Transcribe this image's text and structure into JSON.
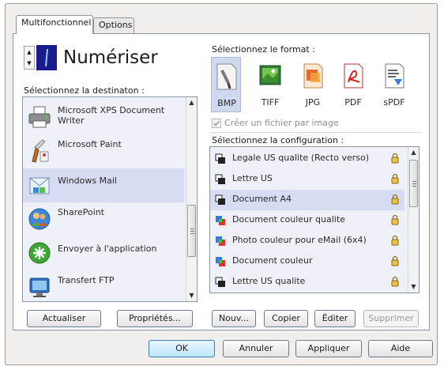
{
  "tabs": {
    "multifunctional": "Multifonctionnel",
    "options": "Options"
  },
  "scan_button": {
    "label": "Numériser"
  },
  "destination": {
    "heading": "Sélectionnez la destinaton :",
    "items": [
      {
        "label": "Microsoft XPS Document Writer",
        "icon": "printer-icon"
      },
      {
        "label": "Microsoft Paint",
        "icon": "paint-icon"
      },
      {
        "label": "Windows Mail",
        "icon": "windows-mail-icon"
      },
      {
        "label": "SharePoint",
        "icon": "sharepoint-icon"
      },
      {
        "label": "Envoyer à l'application",
        "icon": "send-to-application-icon"
      },
      {
        "label": "Transfert FTP",
        "icon": "ftp-transfer-icon"
      }
    ],
    "selected": "Windows Mail"
  },
  "format": {
    "heading": "Sélectionnez le format :",
    "items": [
      {
        "label": "BMP",
        "icon": "bmp-icon"
      },
      {
        "label": "TIFF",
        "icon": "tiff-icon"
      },
      {
        "label": "JPG",
        "icon": "jpg-icon"
      },
      {
        "label": "PDF",
        "icon": "pdf-icon"
      },
      {
        "label": "sPDF",
        "icon": "spdf-icon"
      }
    ],
    "selected": "BMP",
    "checkbox_label": "Créer un fichier par image",
    "checkbox_checked": true
  },
  "configuration": {
    "heading": "Sélectionnez la configuration :",
    "items": [
      {
        "label": "Legale US qualite (Recto verso)",
        "icon": "scanner-icon"
      },
      {
        "label": "Lettre US",
        "icon": "scanner-icon"
      },
      {
        "label": "Document A4",
        "icon": "scanner-icon"
      },
      {
        "label": "Document couleur qualite",
        "icon": "color-scanner-icon"
      },
      {
        "label": "Photo couleur pour eMail (6x4)",
        "icon": "color-scanner-icon"
      },
      {
        "label": "Document couleur",
        "icon": "color-scanner-icon"
      },
      {
        "label": "Lettre US qualite",
        "icon": "scanner-icon"
      }
    ],
    "selected": "Document A4"
  },
  "left_buttons": {
    "refresh": "Actualiser",
    "properties": "Propriétés..."
  },
  "config_buttons": {
    "new": "Nouv...",
    "copy": "Copier",
    "edit": "Éditer",
    "delete": "Supprimer"
  },
  "dialog_buttons": {
    "ok": "OK",
    "cancel": "Annuler",
    "apply": "Appliquer",
    "help": "Aide"
  },
  "colors": {
    "selection": "#d7dcf4",
    "list_background": "#eef2f8",
    "scan_icon_blue": "#1a1a8c",
    "dialog_background": "#f0efed"
  }
}
